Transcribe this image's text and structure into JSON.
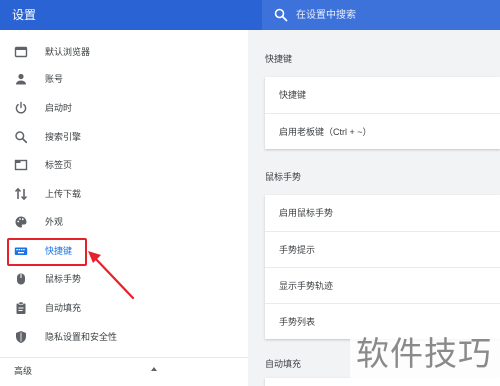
{
  "header": {
    "title": "设置",
    "search_placeholder": "在设置中搜索",
    "accent_color": "#2a64d4"
  },
  "sidebar": {
    "items": [
      {
        "label": "默认浏览器",
        "icon": "browser-window-icon"
      },
      {
        "label": "账号",
        "icon": "person-icon"
      },
      {
        "label": "启动时",
        "icon": "power-icon"
      },
      {
        "label": "搜索引擎",
        "icon": "search-icon"
      },
      {
        "label": "标签页",
        "icon": "tab-icon"
      },
      {
        "label": "上传下载",
        "icon": "up-down-arrows-icon"
      },
      {
        "label": "外观",
        "icon": "palette-icon"
      },
      {
        "label": "快捷键",
        "icon": "keyboard-icon",
        "active": true
      },
      {
        "label": "鼠标手势",
        "icon": "mouse-icon"
      },
      {
        "label": "自动填充",
        "icon": "clipboard-icon"
      },
      {
        "label": "隐私设置和安全性",
        "icon": "shield-icon"
      }
    ],
    "advanced_label": "高级"
  },
  "main": {
    "sections": [
      {
        "title": "快捷键",
        "rows": [
          "快捷键",
          "启用老板键（Ctrl + ~）"
        ]
      },
      {
        "title": "鼠标手势",
        "rows": [
          "启用鼠标手势",
          "手势提示",
          "显示手势轨迹",
          "手势列表"
        ]
      },
      {
        "title": "自动填充",
        "rows": []
      }
    ]
  },
  "annotation": {
    "highlight_color": "#e8202a"
  },
  "watermark": {
    "text": "软件技巧"
  }
}
